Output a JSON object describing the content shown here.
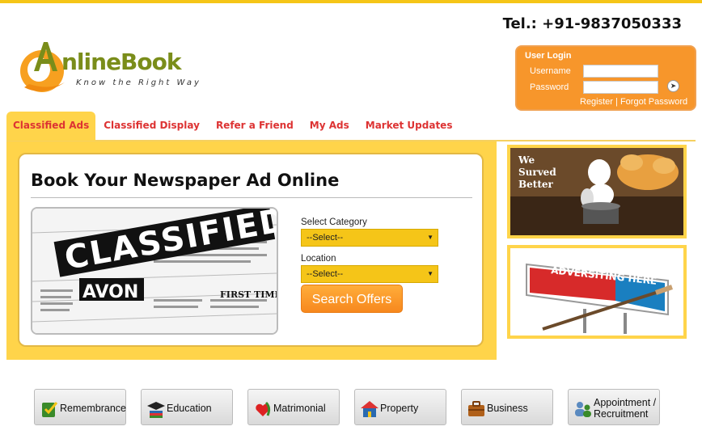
{
  "header": {
    "telephone": "Tel.: +91-9837050333",
    "logo_word": "nlineBook",
    "logo_tagline": "Know the Right Way"
  },
  "login": {
    "title": "User Login",
    "username_label": "Username",
    "password_label": "Password",
    "username_value": "",
    "password_value": "",
    "register_link": "Register",
    "separator": "|",
    "forgot_link": "Forgot Password"
  },
  "nav": {
    "tabs": [
      {
        "label": "Classified Ads",
        "active": true
      },
      {
        "label": "Classified Display",
        "active": false
      },
      {
        "label": "Refer a Friend",
        "active": false
      },
      {
        "label": "My Ads",
        "active": false
      },
      {
        "label": "Market Updates",
        "active": false
      }
    ]
  },
  "main": {
    "title": "Book Your Newspaper Ad Online",
    "category_label": "Select Category",
    "category_selected": "--Select--",
    "location_label": "Location",
    "location_selected": "--Select--",
    "search_button": "Search Offers"
  },
  "side_ads": {
    "chef_caption": "We Surved Better",
    "billboard_text": "ADVERSITING HERE"
  },
  "categories": [
    {
      "label": "Remembrance",
      "icon": "remembrance-icon"
    },
    {
      "label": "Education",
      "icon": "graduation-cap-icon"
    },
    {
      "label": "Matrimonial",
      "icon": "heart-icon"
    },
    {
      "label": "Property",
      "icon": "house-icon"
    },
    {
      "label": "Business",
      "icon": "briefcase-icon"
    },
    {
      "label": "Appointment / Recruitment",
      "icon": "people-icon"
    }
  ],
  "colors": {
    "accent_yellow": "#ffd44a",
    "login_orange": "#f7962b",
    "tab_red": "#dd3333",
    "select_yellow": "#f5c518"
  }
}
